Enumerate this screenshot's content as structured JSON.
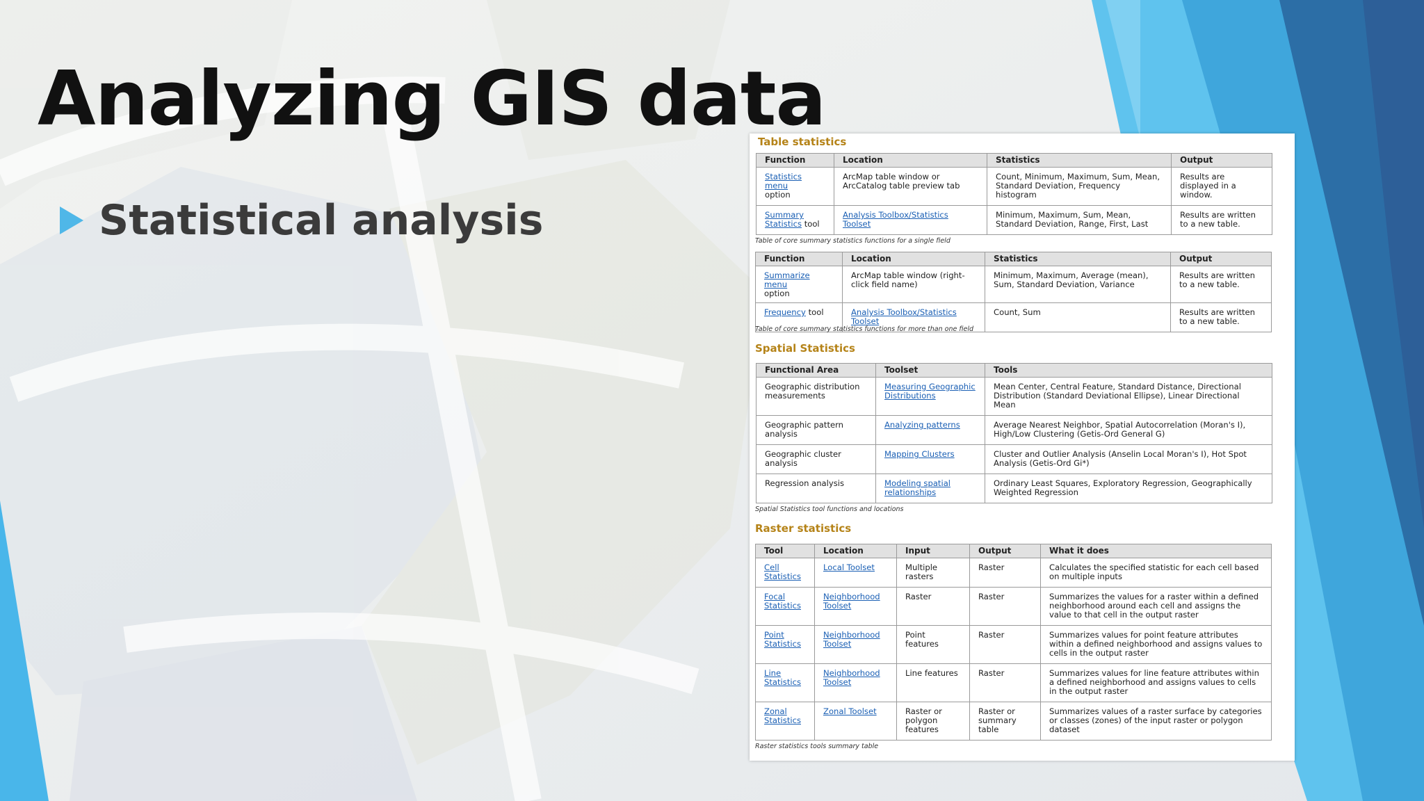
{
  "slide": {
    "title": "Analyzing GIS data",
    "bullet": "Statistical analysis"
  },
  "colors": {
    "accent": "#4fb7e8",
    "section_heading": "#b58318",
    "link": "#1a5fb4"
  },
  "doc": {
    "table_statistics": {
      "heading": "Table statistics",
      "single_field": {
        "headers": [
          "Function",
          "Location",
          "Statistics",
          "Output"
        ],
        "rows": [
          {
            "fn_link": "Statistics menu",
            "fn_rest": "option",
            "location": "ArcMap table window or ArcCatalog table preview tab",
            "statistics": "Count, Minimum, Maximum, Sum, Mean, Standard Deviation, Frequency histogram",
            "output": "Results are displayed in a window."
          },
          {
            "fn_link": "Summary Statistics",
            "fn_rest": "tool",
            "location_link": "Analysis Toolbox/Statistics Toolset",
            "statistics": "Minimum, Maximum, Sum, Mean, Standard Deviation, Range, First, Last",
            "output": "Results are written to a new table."
          }
        ],
        "caption": "Table of core summary statistics functions for a single field"
      },
      "multi_field": {
        "headers": [
          "Function",
          "Location",
          "Statistics",
          "Output"
        ],
        "rows": [
          {
            "fn_link": "Summarize menu",
            "fn_rest": "option",
            "location": "ArcMap table window (right-click field name)",
            "statistics": "Minimum, Maximum, Average (mean), Sum, Standard Deviation, Variance",
            "output": "Results are written to a new table."
          },
          {
            "fn_link": "Frequency",
            "fn_rest": "tool",
            "location_link": "Analysis Toolbox/Statistics Toolset",
            "statistics": "Count, Sum",
            "output": "Results are written to a new table."
          }
        ],
        "caption": "Table of core summary statistics functions for more than one field"
      }
    },
    "spatial_statistics": {
      "heading": "Spatial Statistics",
      "headers": [
        "Functional Area",
        "Toolset",
        "Tools"
      ],
      "rows": [
        {
          "area": "Geographic distribution measurements",
          "toolset": "Measuring Geographic Distributions",
          "tools": "Mean Center, Central Feature, Standard Distance, Directional Distribution (Standard Deviational Ellipse), Linear Directional Mean"
        },
        {
          "area": "Geographic pattern analysis",
          "toolset": "Analyzing patterns",
          "tools": "Average Nearest Neighbor, Spatial Autocorrelation (Moran's I), High/Low Clustering (Getis-Ord General G)"
        },
        {
          "area": "Geographic cluster analysis",
          "toolset": "Mapping Clusters",
          "tools": "Cluster and Outlier Analysis (Anselin Local Moran's I), Hot Spot Analysis (Getis-Ord Gi*)"
        },
        {
          "area": "Regression analysis",
          "toolset": "Modeling spatial relationships",
          "tools": "Ordinary Least Squares, Exploratory Regression, Geographically Weighted Regression"
        }
      ],
      "caption": "Spatial Statistics tool functions and locations"
    },
    "raster_statistics": {
      "heading": "Raster statistics",
      "headers": [
        "Tool",
        "Location",
        "Input",
        "Output",
        "What it does"
      ],
      "rows": [
        {
          "tool": "Cell Statistics",
          "location": "Local Toolset",
          "input": "Multiple rasters",
          "output": "Raster",
          "does": "Calculates the specified statistic for each cell based on multiple inputs"
        },
        {
          "tool": "Focal Statistics",
          "location": "Neighborhood Toolset",
          "input": "Raster",
          "output": "Raster",
          "does": "Summarizes the values for a raster within a defined neighborhood around each cell and assigns the value to that cell in the output raster"
        },
        {
          "tool": "Point Statistics",
          "location": "Neighborhood Toolset",
          "input": "Point features",
          "output": "Raster",
          "does": "Summarizes values for point feature attributes within a defined neighborhood and assigns values to cells in the output raster"
        },
        {
          "tool": "Line Statistics",
          "location": "Neighborhood Toolset",
          "input": "Line features",
          "output": "Raster",
          "does": "Summarizes values for line feature attributes within a defined neighborhood and assigns values to cells in the output raster"
        },
        {
          "tool": "Zonal Statistics",
          "location": "Zonal Toolset",
          "input": "Raster or polygon features",
          "output": "Raster or summary table",
          "does": "Summarizes values of a raster surface by categories or classes (zones) of the input raster or polygon dataset"
        }
      ],
      "caption": "Raster statistics tools summary table"
    }
  }
}
